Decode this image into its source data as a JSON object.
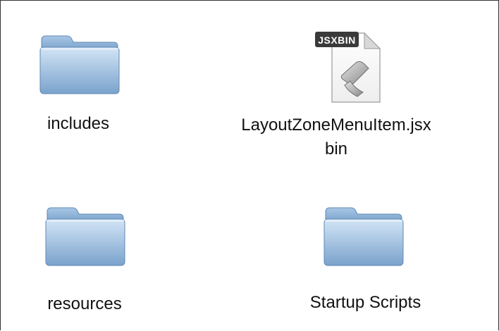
{
  "window": {
    "view": "icon-view"
  },
  "items": [
    {
      "name": "includes",
      "kind": "folder",
      "icon": "folder-icon"
    },
    {
      "name": "LayoutZoneMenuItem.jsxbin",
      "kind": "file",
      "icon": "jsxbin-file-icon",
      "badge": "JSXBIN"
    },
    {
      "name": "resources",
      "kind": "folder",
      "icon": "folder-icon"
    },
    {
      "name": "Startup Scripts",
      "kind": "folder",
      "icon": "folder-icon"
    }
  ],
  "colors": {
    "folder_top": "#c6dcf0",
    "folder_bottom": "#6e99c4",
    "folder_edge": "#5f88b4",
    "badge_bg": "#3a3a3a",
    "badge_text": "#ffffff"
  }
}
